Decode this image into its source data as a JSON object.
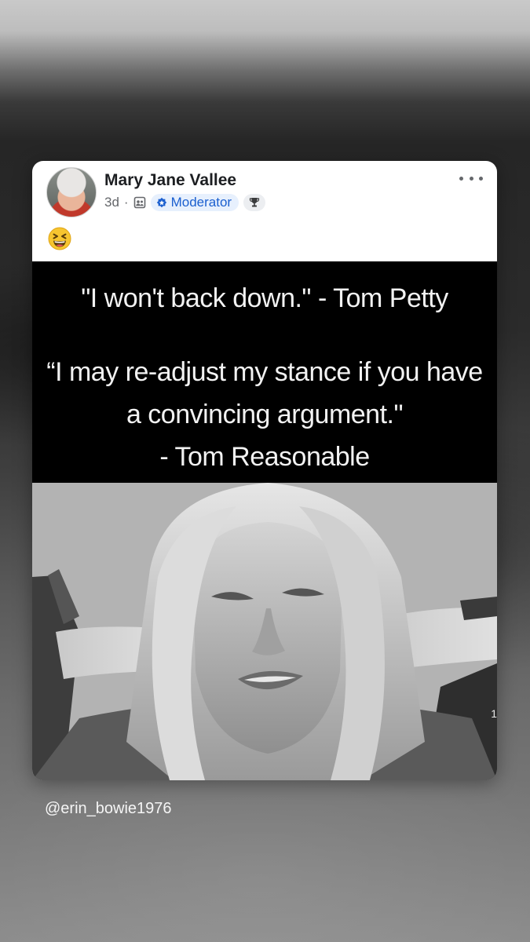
{
  "post": {
    "author": "Mary Jane Vallee",
    "time": "3d",
    "separator": "·",
    "role_badge": "Moderator",
    "emoji": "laughing-squinting-face",
    "more_icon": "more-horizontal-icon"
  },
  "meme": {
    "quote_1": "\"I won't back down.\" - Tom Petty",
    "quote_2_line_1": "“I may re-adjust my stance if you have",
    "quote_2_line_2": "a convincing argument.\"",
    "quote_2_line_3": "- Tom Reasonable",
    "side_mark": "1"
  },
  "watermark": {
    "handle": "@erin_bowie1976"
  },
  "colors": {
    "badge_blue": "#1b5fcf",
    "badge_bg": "#e7f0fd",
    "meta_gray": "#65676b"
  }
}
